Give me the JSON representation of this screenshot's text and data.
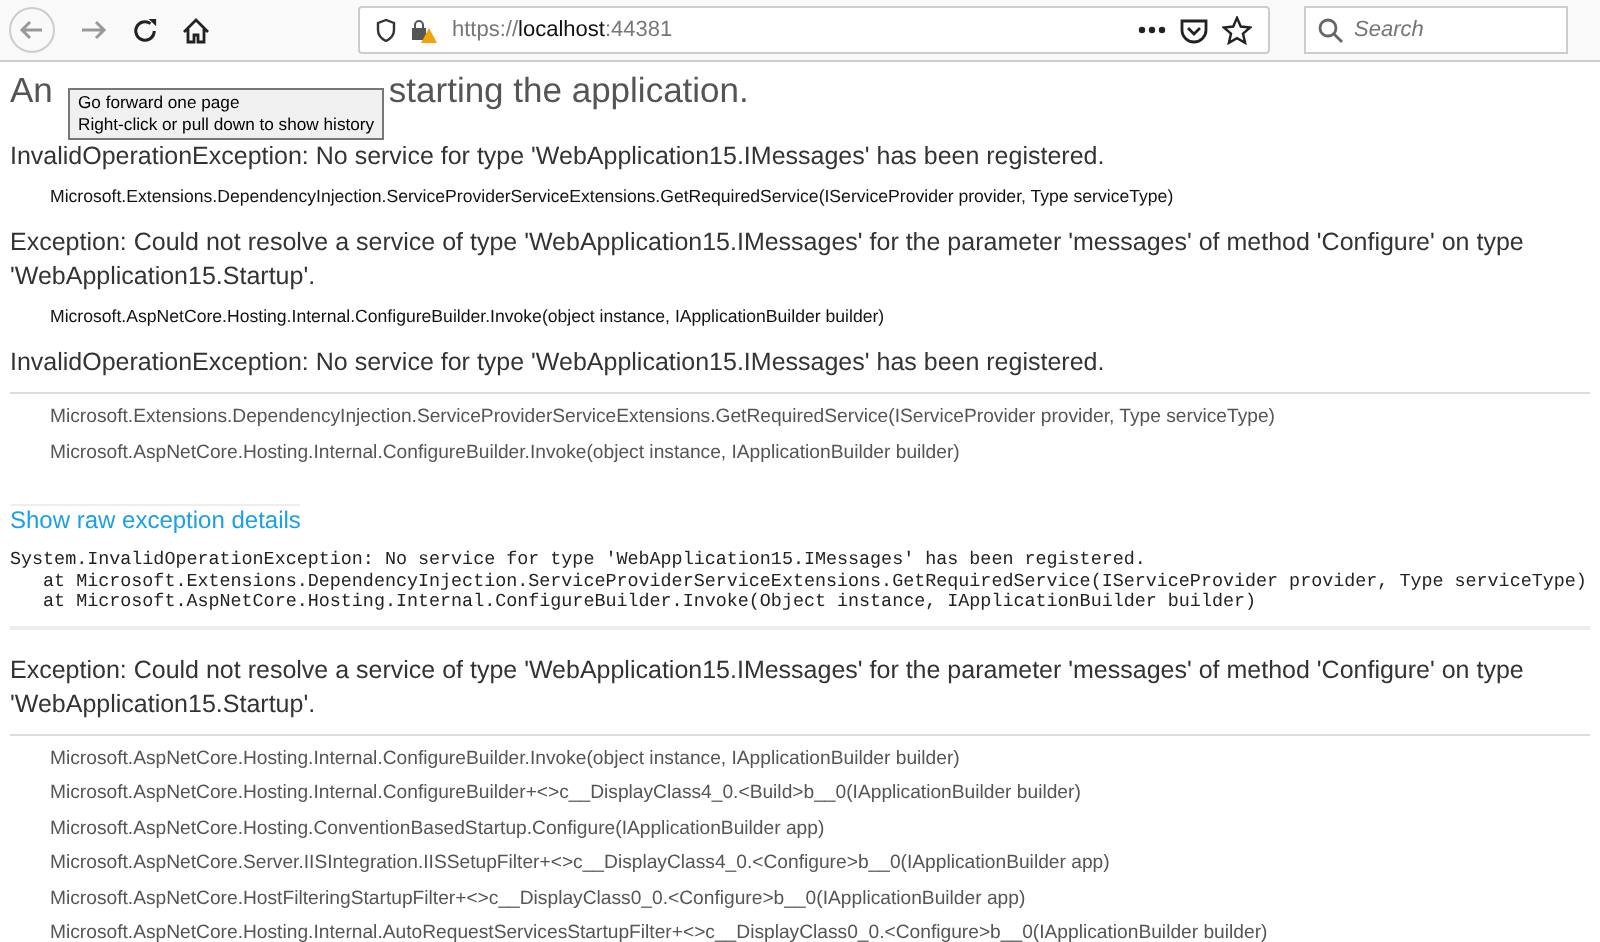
{
  "toolbar": {
    "url_scheme": "https://",
    "url_host": "localhost",
    "url_port": ":44381",
    "search_placeholder": "Search"
  },
  "tooltip": {
    "lines": [
      "Go forward one page",
      "Right-click or pull down to show history"
    ]
  },
  "title": [
    "An",
    "starting the application."
  ],
  "summary": [
    {
      "message": "InvalidOperationException: No service for type 'WebApplication15.IMessages' has been registered.",
      "frames": [
        "Microsoft.Extensions.DependencyInjection.ServiceProviderServiceExtensions.GetRequiredService(IServiceProvider provider, Type serviceType)"
      ]
    },
    {
      "message": "Exception: Could not resolve a service of type 'WebApplication15.IMessages' for the parameter 'messages' of method 'Configure' on type 'WebApplication15.Startup'.",
      "frames": [
        "Microsoft.AspNetCore.Hosting.Internal.ConfigureBuilder.Invoke(object instance, IApplicationBuilder builder)"
      ]
    }
  ],
  "details": [
    {
      "message": "InvalidOperationException: No service for type 'WebApplication15.IMessages' has been registered.",
      "frames": [
        "Microsoft.Extensions.DependencyInjection.ServiceProviderServiceExtensions.GetRequiredService(IServiceProvider provider, Type serviceType)",
        "Microsoft.AspNetCore.Hosting.Internal.ConfigureBuilder.Invoke(object instance, IApplicationBuilder builder)"
      ],
      "raw_link": "Show raw exception details",
      "raw": [
        "System.InvalidOperationException: No service for type 'WebApplication15.IMessages' has been registered.",
        "   at Microsoft.Extensions.DependencyInjection.ServiceProviderServiceExtensions.GetRequiredService(IServiceProvider provider, Type serviceType)",
        "   at Microsoft.AspNetCore.Hosting.Internal.ConfigureBuilder.Invoke(Object instance, IApplicationBuilder builder)"
      ]
    },
    {
      "message": "Exception: Could not resolve a service of type 'WebApplication15.IMessages' for the parameter 'messages' of method 'Configure' on type 'WebApplication15.Startup'.",
      "frames": [
        "Microsoft.AspNetCore.Hosting.Internal.ConfigureBuilder.Invoke(object instance, IApplicationBuilder builder)",
        "Microsoft.AspNetCore.Hosting.Internal.ConfigureBuilder+<>c__DisplayClass4_0.<Build>b__0(IApplicationBuilder builder)",
        "Microsoft.AspNetCore.Hosting.ConventionBasedStartup.Configure(IApplicationBuilder app)",
        "Microsoft.AspNetCore.Server.IISIntegration.IISSetupFilter+<>c__DisplayClass4_0.<Configure>b__0(IApplicationBuilder app)",
        "Microsoft.AspNetCore.HostFilteringStartupFilter+<>c__DisplayClass0_0.<Configure>b__0(IApplicationBuilder app)",
        "Microsoft.AspNetCore.Hosting.Internal.AutoRequestServicesStartupFilter+<>c__DisplayClass0_0.<Configure>b__0(IApplicationBuilder builder)"
      ]
    }
  ]
}
